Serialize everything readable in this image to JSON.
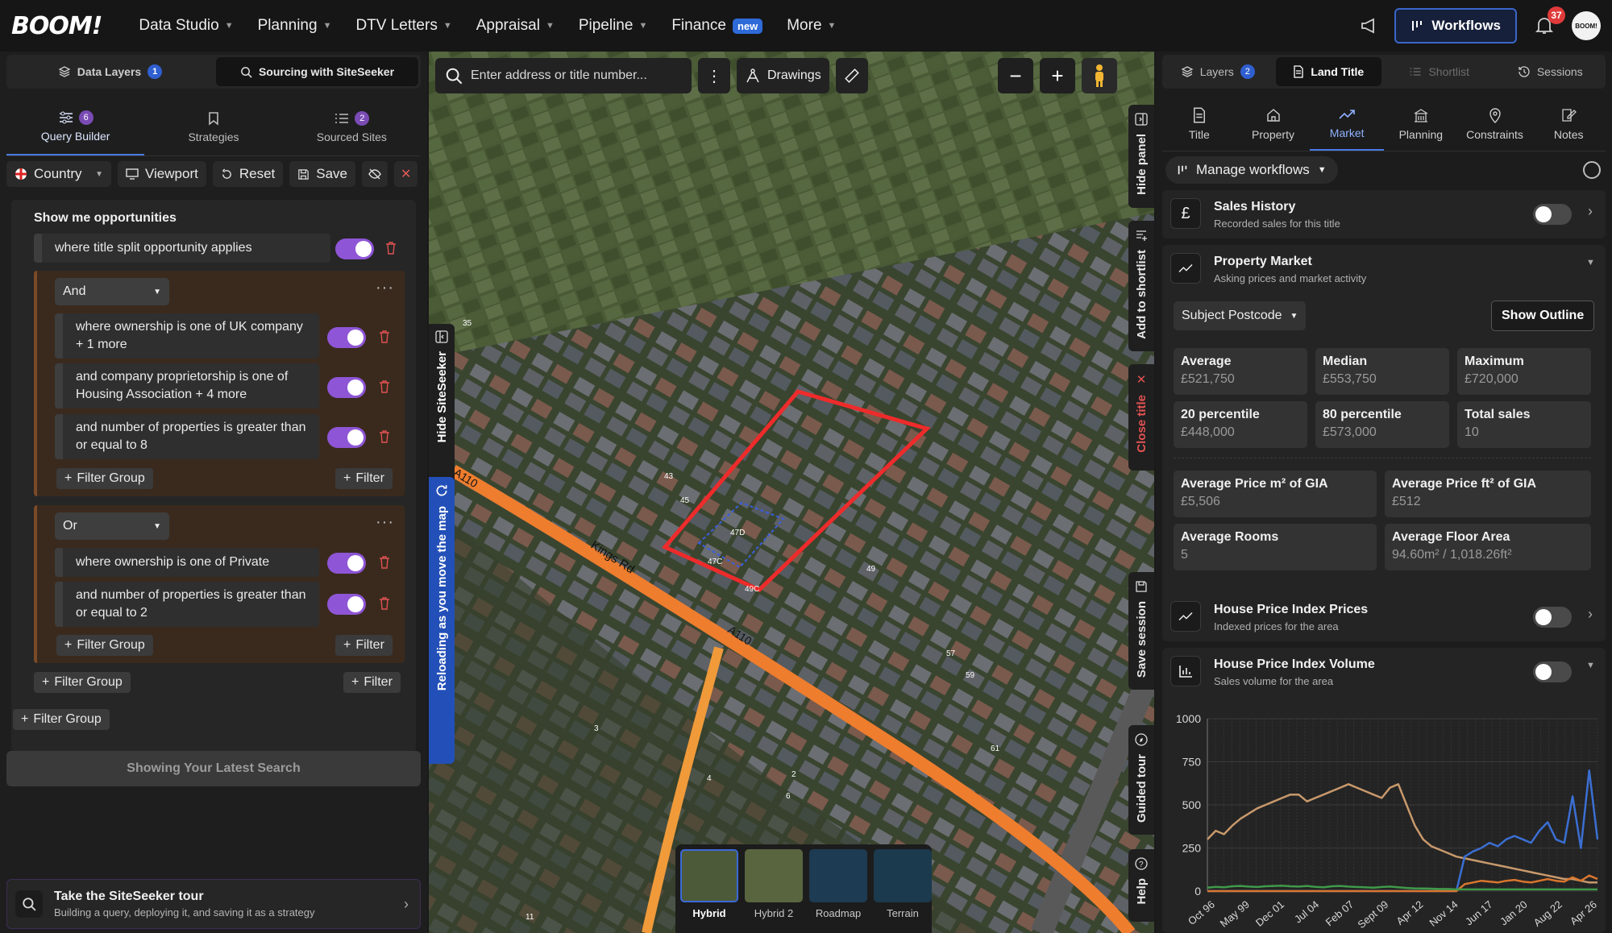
{
  "app": {
    "logo": "BOOM!"
  },
  "nav": {
    "items": [
      {
        "label": "Data Studio"
      },
      {
        "label": "Planning"
      },
      {
        "label": "DTV Letters"
      },
      {
        "label": "Appraisal"
      },
      {
        "label": "Pipeline"
      },
      {
        "label": "Finance",
        "badge": "new"
      },
      {
        "label": "More"
      }
    ],
    "workflows_label": "Workflows",
    "notifications_count": "37",
    "avatar_text": "BOOM!"
  },
  "left": {
    "subtabs": [
      {
        "label": "Data Layers",
        "count": "1"
      },
      {
        "label": "Sourcing with SiteSeeker"
      }
    ],
    "qtabs": [
      {
        "label": "Query Builder",
        "count": "6"
      },
      {
        "label": "Strategies"
      },
      {
        "label": "Sourced Sites",
        "count": "2"
      }
    ],
    "toolbar": {
      "country": "Country",
      "viewport": "Viewport",
      "reset": "Reset",
      "save": "Save"
    },
    "query": {
      "title": "Show me opportunities",
      "rule0": "where title split opportunity applies",
      "group1": {
        "op": "And",
        "rules": [
          "where ownership is one of UK company + 1 more",
          "and company proprietorship is one of Housing Association + 4 more",
          "and number of properties is greater than or equal to 8"
        ]
      },
      "group2": {
        "op": "Or",
        "rules": [
          "where ownership is one of Private",
          "and number of properties is greater than or equal to 2"
        ]
      },
      "filter_group": "Filter Group",
      "filter": "Filter"
    },
    "latest": "Showing Your Latest Search",
    "tour": {
      "title": "Take the SiteSeeker tour",
      "sub": "Building a query, deploying it, and saving it as a strategy"
    }
  },
  "map": {
    "search_placeholder": "Enter address or title number...",
    "drawings": "Drawings",
    "hide_siteseeker": "Hide SiteSeeker",
    "reloading": "Reloading as you move the map",
    "hide_panel": "Hide panel",
    "add_shortlist": "Add to shortlist",
    "close_title": "Close title",
    "save_session": "Save session",
    "guided_tour": "Guided tour",
    "help": "Help",
    "road_labels": [
      "A110",
      "Kings Rd",
      "A110"
    ],
    "house_numbers": [
      "35",
      "43",
      "45",
      "47D",
      "47C",
      "49C",
      "49",
      "57",
      "59",
      "61",
      "3",
      "2",
      "6",
      "11",
      "4"
    ],
    "basemaps": [
      {
        "label": "Hybrid"
      },
      {
        "label": "Hybrid 2"
      },
      {
        "label": "Roadmap"
      },
      {
        "label": "Terrain"
      }
    ]
  },
  "right": {
    "tabs": [
      {
        "label": "Layers",
        "count": "2"
      },
      {
        "label": "Land Title"
      },
      {
        "label": "Shortlist"
      },
      {
        "label": "Sessions"
      }
    ],
    "dtabs": [
      {
        "label": "Title"
      },
      {
        "label": "Property"
      },
      {
        "label": "Market"
      },
      {
        "label": "Planning"
      },
      {
        "label": "Constraints"
      },
      {
        "label": "Notes"
      }
    ],
    "manage_workflows": "Manage workflows",
    "sales_history": {
      "title": "Sales History",
      "sub": "Recorded sales for this title"
    },
    "property_market": {
      "title": "Property Market",
      "sub": "Asking prices and market activity"
    },
    "subject_postcode": "Subject Postcode",
    "show_outline": "Show Outline",
    "stats": [
      {
        "k": "Average",
        "v": "£521,750"
      },
      {
        "k": "Median",
        "v": "£553,750"
      },
      {
        "k": "Maximum",
        "v": "£720,000"
      },
      {
        "k": "20 percentile",
        "v": "£448,000"
      },
      {
        "k": "80 percentile",
        "v": "£573,000"
      },
      {
        "k": "Total sales",
        "v": "10"
      }
    ],
    "stats2": [
      {
        "k": "Average Price m² of GIA",
        "v": "£5,506"
      },
      {
        "k": "Average Price ft² of GIA",
        "v": "£512"
      },
      {
        "k": "Average Rooms",
        "v": "5"
      },
      {
        "k": "Average Floor Area",
        "v": "94.60m² / 1,018.26ft²"
      }
    ],
    "hpi_prices": {
      "title": "House Price Index Prices",
      "sub": "Indexed prices for the area"
    },
    "hpi_volume": {
      "title": "House Price Index Volume",
      "sub": "Sales volume for the area"
    }
  },
  "chart_data": {
    "type": "line",
    "title": "",
    "xlabel": "",
    "ylabel": "",
    "ylim": [
      0,
      1000
    ],
    "yticks": [
      0,
      250,
      500,
      750,
      1000
    ],
    "xticks": [
      "Oct 96",
      "May 99",
      "Dec 01",
      "Jul 04",
      "Feb 07",
      "Sept 09",
      "Apr 12",
      "Nov 14",
      "Jun 17",
      "Jan 20",
      "Aug 22",
      "Apr 26"
    ],
    "series": [
      {
        "color": "#c8996c",
        "values": [
          300,
          350,
          330,
          380,
          420,
          450,
          480,
          500,
          520,
          540,
          560,
          560,
          520,
          540,
          560,
          580,
          600,
          620,
          600,
          580,
          560,
          540,
          600,
          620,
          500,
          380,
          300,
          260,
          240,
          220,
          200,
          190,
          180,
          170,
          160,
          150,
          140,
          130,
          120,
          110,
          100,
          90,
          80,
          70,
          70,
          60,
          50,
          50
        ]
      },
      {
        "color": "#3b6fd3",
        "values": [
          0,
          0,
          0,
          0,
          0,
          0,
          0,
          0,
          0,
          0,
          0,
          0,
          0,
          0,
          0,
          0,
          0,
          0,
          0,
          0,
          0,
          0,
          0,
          0,
          0,
          0,
          0,
          0,
          0,
          0,
          0,
          200,
          230,
          250,
          280,
          260,
          300,
          320,
          300,
          280,
          350,
          400,
          300,
          280,
          550,
          250,
          700,
          300
        ]
      },
      {
        "color": "#d9762e",
        "values": [
          0,
          0,
          0,
          0,
          0,
          0,
          0,
          0,
          0,
          0,
          0,
          0,
          0,
          0,
          0,
          0,
          0,
          0,
          0,
          0,
          0,
          0,
          0,
          0,
          0,
          0,
          0,
          0,
          0,
          0,
          0,
          40,
          50,
          60,
          55,
          50,
          60,
          65,
          55,
          50,
          60,
          70,
          60,
          55,
          80,
          60,
          90,
          70
        ]
      },
      {
        "color": "#3f9a4a",
        "values": [
          20,
          25,
          22,
          28,
          30,
          26,
          24,
          28,
          30,
          32,
          28,
          26,
          30,
          25,
          22,
          28,
          30,
          26,
          24,
          22,
          20,
          24,
          26,
          22,
          18,
          16,
          15,
          14,
          12,
          12,
          10,
          10,
          10,
          10,
          10,
          10,
          10,
          10,
          10,
          10,
          10,
          10,
          10,
          10,
          10,
          10,
          10,
          10
        ]
      }
    ]
  }
}
